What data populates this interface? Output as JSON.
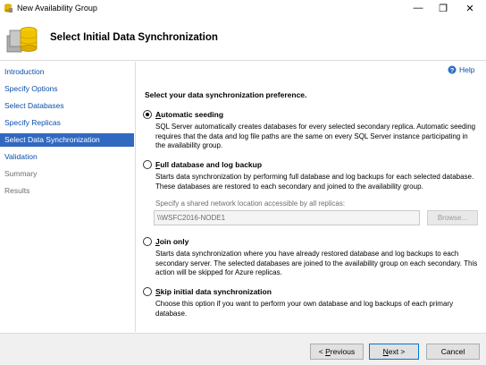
{
  "window": {
    "title": "New Availability Group",
    "min_glyph": "—",
    "max_glyph": "❐",
    "close_glyph": "✕"
  },
  "header": {
    "title": "Select Initial Data Synchronization"
  },
  "nav": {
    "items": [
      {
        "label": "Introduction",
        "state": "link"
      },
      {
        "label": "Specify Options",
        "state": "link"
      },
      {
        "label": "Select Databases",
        "state": "link"
      },
      {
        "label": "Specify Replicas",
        "state": "link"
      },
      {
        "label": "Select Data Synchronization",
        "state": "active"
      },
      {
        "label": "Validation",
        "state": "link"
      },
      {
        "label": "Summary",
        "state": "disabled"
      },
      {
        "label": "Results",
        "state": "disabled"
      }
    ]
  },
  "main": {
    "help_label": "Help",
    "prompt": "Select your data synchronization preference.",
    "options": [
      {
        "label_accel": "A",
        "label_rest": "utomatic seeding",
        "selected": true,
        "description": "SQL Server automatically creates databases for every selected secondary replica. Automatic seeding requires that the data and log file paths are the same on every SQL Server instance participating in the availability group."
      },
      {
        "label_accel": "F",
        "label_rest": "ull database and log backup",
        "selected": false,
        "description": "Starts data synchronization by performing full database and log backups for each selected database. These databases are restored to each secondary and joined to the availability group."
      },
      {
        "label_accel": "J",
        "label_rest": "oin only",
        "selected": false,
        "description": "Starts data synchronization where you have already restored database and log backups to each secondary server. The selected databases are joined to the availability group on each secondary. This action will be skipped for Azure replicas."
      },
      {
        "label_accel": "S",
        "label_rest": "kip initial data synchronization",
        "selected": false,
        "description": "Choose this option if you want to perform your own database and log backups of each primary database."
      }
    ],
    "share": {
      "label": "Specify a shared network location accessible by all replicas:",
      "value": "\\\\WSFC2016-NODE1",
      "browse_label": "Browse..."
    }
  },
  "footer": {
    "prev_accel": "P",
    "prev_rest": "revious",
    "next_accel": "N",
    "next_rest": "ext >",
    "cancel_label": "Cancel"
  },
  "colors": {
    "link": "#0b4fa8",
    "active_bg": "#3168c0",
    "disabled": "#6d6d6d"
  }
}
